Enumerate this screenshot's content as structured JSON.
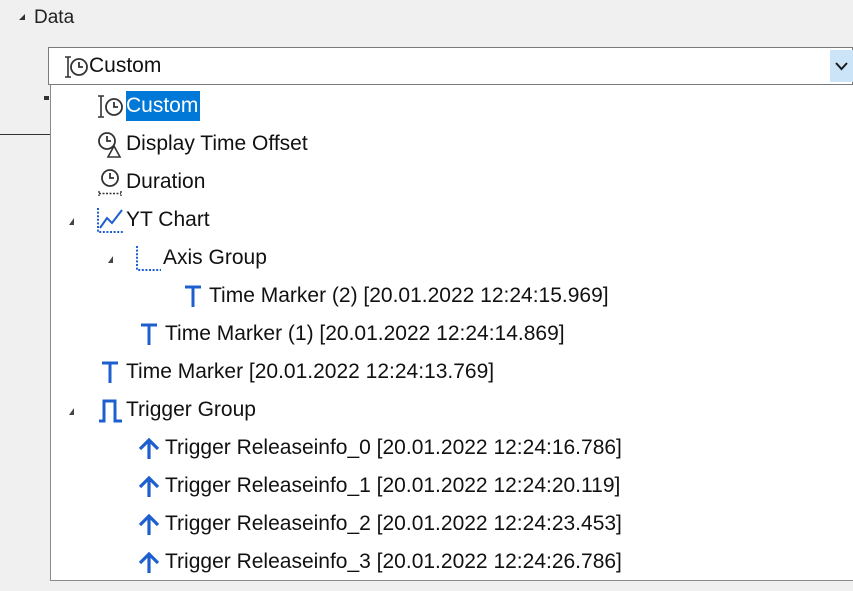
{
  "section": {
    "title": "Data",
    "expanded": true
  },
  "combo": {
    "value": "Custom",
    "icon": "custom-time-icon"
  },
  "tree": {
    "custom": {
      "label": "Custom",
      "icon": "custom-time-icon",
      "selected": true
    },
    "display_time_offset": {
      "label": "Display Time Offset",
      "icon": "time-offset-icon"
    },
    "duration": {
      "label": "Duration",
      "icon": "duration-icon"
    },
    "yt_chart": {
      "label": "YT Chart",
      "icon": "yt-chart-icon",
      "expanded": true
    },
    "axis_group": {
      "label": "Axis Group",
      "icon": "axis-group-icon",
      "expanded": true
    },
    "time_marker_2": {
      "label": "Time Marker (2) [20.01.2022 12:24:15.969]",
      "icon": "time-marker-icon"
    },
    "time_marker_1": {
      "label": "Time Marker (1) [20.01.2022 12:24:14.869]",
      "icon": "time-marker-icon"
    },
    "time_marker": {
      "label": "Time Marker [20.01.2022 12:24:13.769]",
      "icon": "time-marker-icon"
    },
    "trigger_group": {
      "label": "Trigger Group",
      "icon": "trigger-group-icon",
      "expanded": true
    },
    "trigger_0": {
      "label": "Trigger Releaseinfo_0 [20.01.2022 12:24:16.786]",
      "icon": "trigger-icon"
    },
    "trigger_1": {
      "label": "Trigger Releaseinfo_1 [20.01.2022 12:24:20.119]",
      "icon": "trigger-icon"
    },
    "trigger_2": {
      "label": "Trigger Releaseinfo_2 [20.01.2022 12:24:23.453]",
      "icon": "trigger-icon"
    },
    "trigger_3": {
      "label": "Trigger Releaseinfo_3 [20.01.2022 12:24:26.786]",
      "icon": "trigger-icon"
    }
  },
  "colors": {
    "accent": "#0078d7",
    "icon_blue": "#1e5fcf",
    "arrow_bg": "#cce4f7"
  }
}
